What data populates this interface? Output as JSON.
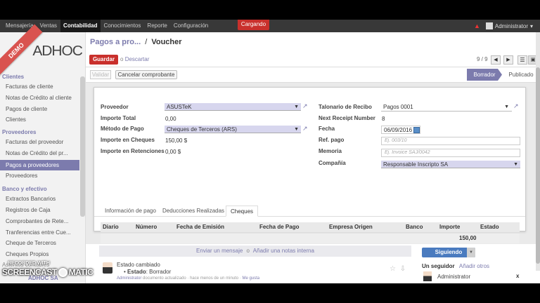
{
  "topbar": {
    "menu": [
      "Mensajería",
      "Ventas",
      "Contabilidad",
      "Conocimientos",
      "Reporte",
      "Configuración"
    ],
    "active_menu": "Contabilidad",
    "loading": "Cargando",
    "user": "Administrator",
    "user_caret": "▾",
    "warning_icon": "warning-icon"
  },
  "sidebar": {
    "demo": "DEMO",
    "logo": "ADHOC",
    "sections": {
      "clientes": "Clientes",
      "proveedores": "Proveedores",
      "banco": "Banco y efectivo"
    },
    "clientes_items": [
      "Facturas de cliente",
      "Notas de Crédito al cliente",
      "Pagos de cliente",
      "Clientes"
    ],
    "proveedores_items": [
      "Facturas del proveedor",
      "Notas de Crédito del pr...",
      "Pagos a proveedores",
      "Proveedores"
    ],
    "banco_items": [
      "Extractos Bancarios",
      "Registros de Caja",
      "Comprobantes de Rete...",
      "Tranferencias entre Cue...",
      "Cheque de Terceros",
      "Cheques Propios"
    ],
    "footer_items": [
      "Asientos contables",
      "Impo..."
    ],
    "company": "ADHOC SA"
  },
  "header": {
    "breadcrumb_parent": "Pagos a pro...",
    "breadcrumb_sep": "/",
    "breadcrumb_current": "Voucher",
    "save": "Guardar",
    "discard_or": "o",
    "discard": "Descartar",
    "pager": "9 / 9",
    "validate": "Validar",
    "cancel_voucher": "Cancelar comprobante",
    "status_draft": "Borrador",
    "status_posted": "Publicado"
  },
  "form": {
    "labels": {
      "proveedor": "Proveedor",
      "importe_total": "Importe Total",
      "metodo_pago": "Método de Pago",
      "importe_cheques": "Importe en Cheques",
      "importe_retenciones": "Importe en Retenciones",
      "talonario": "Talonario de Recibo",
      "next_receipt": "Next Receipt Number",
      "fecha": "Fecha",
      "ref_pago": "Ref. pago",
      "memoria": "Memoria",
      "compania": "Compañía"
    },
    "values": {
      "proveedor": "ASUSTeK",
      "importe_total": "0,00",
      "metodo_pago": "Cheques de Terceros (ARS)",
      "importe_cheques": "150,00 $",
      "importe_retenciones": "0,00 $",
      "talonario": "Pagos 0001",
      "next_receipt": "8",
      "fecha": "06/09/2016",
      "compania": "Responsable Inscripto SA"
    },
    "placeholders": {
      "ref_pago": "Ej. 003/10",
      "memoria": "Ej. Invoice SAJ/0042"
    },
    "tabs": [
      "Información de pago",
      "Deducciones Realizadas",
      "Cheques"
    ],
    "active_tab": "Cheques",
    "table": {
      "columns": [
        "Diario",
        "Número",
        "Fecha de Emisión",
        "Fecha de Pago",
        "Empresa Origen",
        "Banco",
        "Importe",
        "Estado"
      ],
      "total": "150,00"
    }
  },
  "chatter": {
    "send_message": "Enviar un mensaje",
    "or": "o",
    "add_note": "Añadir una notas interna",
    "msg_title": "Estado cambiado",
    "msg_field": "Estado",
    "msg_value": "Borrador",
    "msg_author": "Administrator",
    "msg_text": "documento actualizado",
    "msg_time": "hace menos de un minuto",
    "msg_like": "Me gusta",
    "follow": "Siguiendo",
    "followers_count": "Un seguidor",
    "add_others": "Añadir otros",
    "follower_name": "Administrator",
    "remove": "x"
  },
  "watermark": {
    "recorded": "RECORDED WITH",
    "brand_left": "SCREENCAST",
    "brand_right": "MATIC"
  },
  "colors": {
    "primary": "#7c7bad",
    "danger": "#c9302c",
    "topbar": "#383838",
    "follow": "#4a7bbf"
  }
}
